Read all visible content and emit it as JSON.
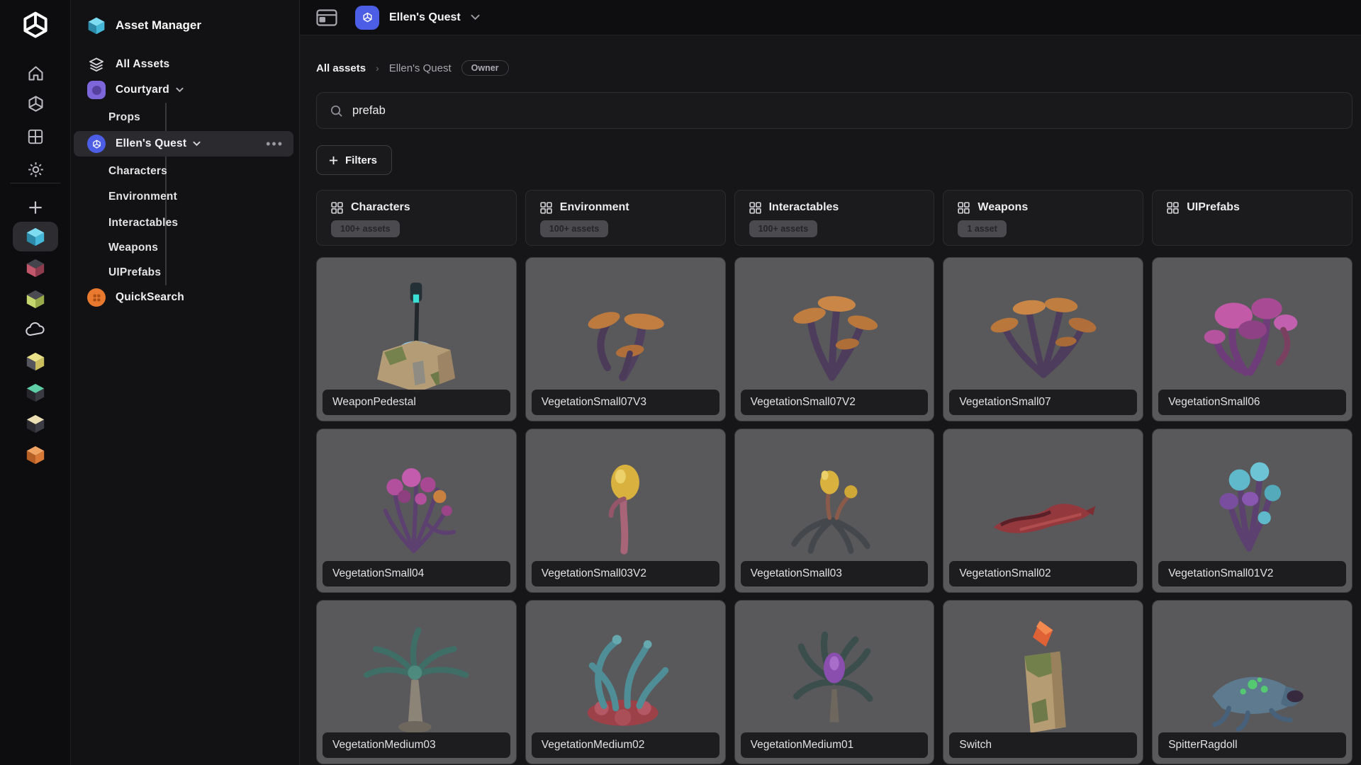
{
  "rail": {
    "icons": [
      "unity-logo",
      "home-icon",
      "box-icon",
      "grid-icon",
      "gear-icon",
      "add-icon"
    ],
    "projects": [
      "project-teal-selected",
      "project-red",
      "project-lime",
      "project-cloud",
      "project-yellow",
      "project-teal-dark",
      "project-cream",
      "project-orange"
    ]
  },
  "sidebar": {
    "title": "Asset Manager",
    "all_assets": "All Assets",
    "courtyard": "Courtyard",
    "courtyard_children": [
      "Props"
    ],
    "ellens_quest": "Ellen's Quest",
    "eq_children": [
      "Characters",
      "Environment",
      "Interactables",
      "Weapons",
      "UIPrefabs"
    ],
    "quicksearch": "QuickSearch"
  },
  "topbar": {
    "project": "Ellen's Quest"
  },
  "breadcrumb": {
    "root": "All assets",
    "current": "Ellen's Quest",
    "badge": "Owner"
  },
  "search": {
    "value": "prefab"
  },
  "filters": {
    "label": "Filters"
  },
  "categories": [
    {
      "label": "Characters",
      "count": "100+ assets"
    },
    {
      "label": "Environment",
      "count": "100+ assets"
    },
    {
      "label": "Interactables",
      "count": "100+ assets"
    },
    {
      "label": "Weapons",
      "count": "1 asset"
    },
    {
      "label": "UIPrefabs",
      "count": ""
    }
  ],
  "assets": [
    "WeaponPedestal",
    "VegetationSmall07V3",
    "VegetationSmall07V2",
    "VegetationSmall07",
    "VegetationSmall06",
    "VegetationSmall04",
    "VegetationSmall03V2",
    "VegetationSmall03",
    "VegetationSmall02",
    "VegetationSmall01V2",
    "VegetationMedium03",
    "VegetationMedium02",
    "VegetationMedium01",
    "Switch",
    "SpitterRagdoll"
  ],
  "colors": {
    "accent_blue": "#4c5ee5",
    "courtyard_purple": "#7d66d9",
    "quicksearch_orange": "#e8792e",
    "selected_row_bg": "#2b2b2f",
    "thumb_grey": "#59595c"
  }
}
